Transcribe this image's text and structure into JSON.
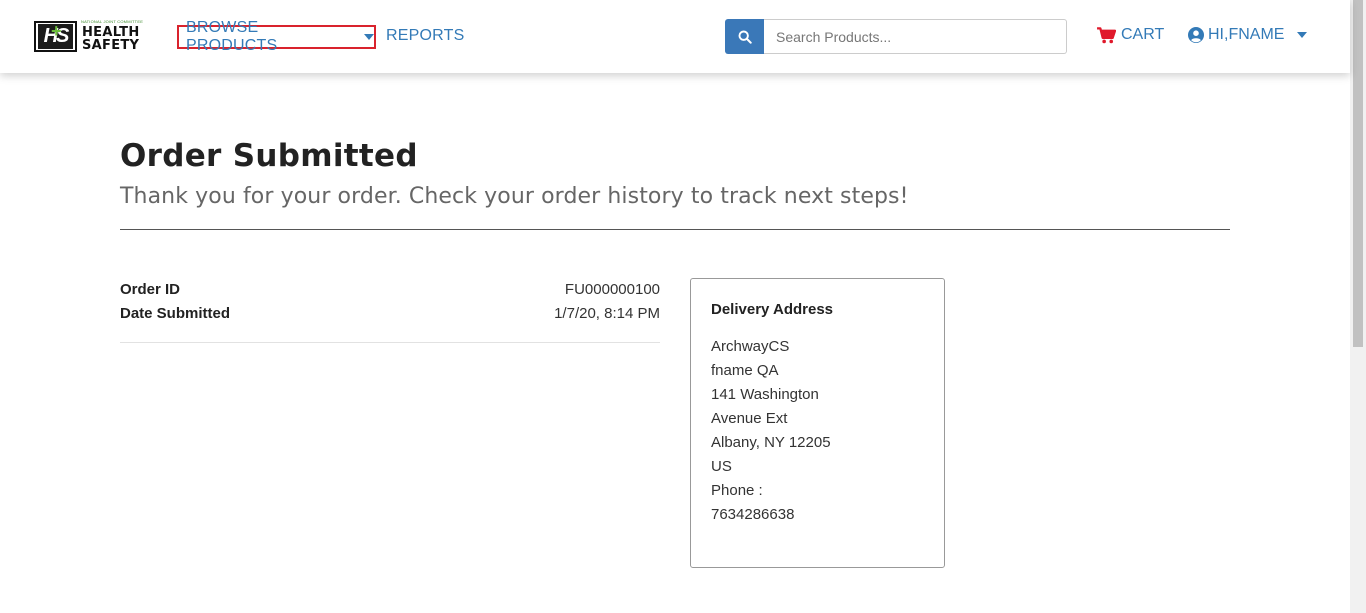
{
  "header": {
    "logo": {
      "small_text": "NATIONAL JOINT COMMITTEE",
      "line1": "HEALTH",
      "line2": "SAFETY",
      "mark": "HS"
    },
    "nav": {
      "browse_label": "BROWSE PRODUCTS",
      "reports_label": "REPORTS"
    },
    "search": {
      "placeholder": "Search Products...",
      "value": "",
      "icon": "search-icon"
    },
    "cart_label": "CART",
    "user_label": "HI,FNAME",
    "colors": {
      "link": "#337ab7",
      "cart_icon": "#e0192b",
      "highlight_border": "#d9232d",
      "search_button": "#3a78b8"
    }
  },
  "main": {
    "title": "Order Submitted",
    "subtitle": "Thank you for your order. Check your order history to track next steps!",
    "order": {
      "id_label": "Order ID",
      "id_value": "FU000000100",
      "date_label": "Date Submitted",
      "date_value": "1/7/20, 8:14 PM"
    },
    "delivery": {
      "title": "Delivery Address",
      "lines": [
        "ArchwayCS",
        "fname QA",
        "141 Washington",
        "Avenue Ext",
        "Albany, NY 12205",
        "US",
        "Phone :",
        "7634286638"
      ]
    }
  }
}
